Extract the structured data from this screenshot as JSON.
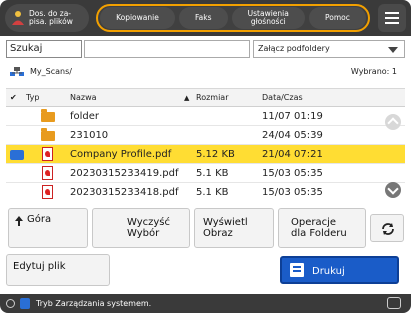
{
  "topbar": {
    "doc_button": "Dos. do za-\npisa. plików",
    "tabs": [
      "Kopiowanie",
      "Faks",
      "Ustawienia\ngłośności",
      "Pomoc"
    ],
    "accent": "#f2a000"
  },
  "search": {
    "label": "Szukaj",
    "value": "",
    "include_subfolders": "Załącz podfoldery"
  },
  "path": {
    "text": "My_Scans/",
    "selected_label": "Wybrano: 1"
  },
  "table": {
    "headers": [
      "Typ",
      "Nazwa",
      "Rozmiar",
      "Data/Czas"
    ],
    "rows": [
      {
        "type": "folder",
        "name": "folder",
        "size": "",
        "date": "11/07 01:19",
        "selected": false
      },
      {
        "type": "folder",
        "name": "231010",
        "size": "",
        "date": "24/04 05:39",
        "selected": false
      },
      {
        "type": "pdf",
        "name": "Company Profile.pdf",
        "size": "5.12 KB",
        "date": "21/04 07:21",
        "selected": true
      },
      {
        "type": "pdf",
        "name": "20230315233419.pdf",
        "size": "5.1 KB",
        "date": "15/03 05:35",
        "selected": false
      },
      {
        "type": "pdf",
        "name": "20230315233418.pdf",
        "size": "5.1 KB",
        "date": "15/03 05:35",
        "selected": false
      }
    ]
  },
  "buttons": {
    "up": "Góra",
    "clear": "Wyczyść\nWybór",
    "preview": "Wyświetl\nObraz",
    "folder_ops": "Operacje\ndla Folderu",
    "edit": "Edytuj plik",
    "print": "Drukuj"
  },
  "status": {
    "text": "Tryb Zarządzania systemem."
  },
  "colors": {
    "selected_row": "#ffdd33",
    "print_button": "#1a5cc8",
    "topbar": "#3a3a3a"
  }
}
